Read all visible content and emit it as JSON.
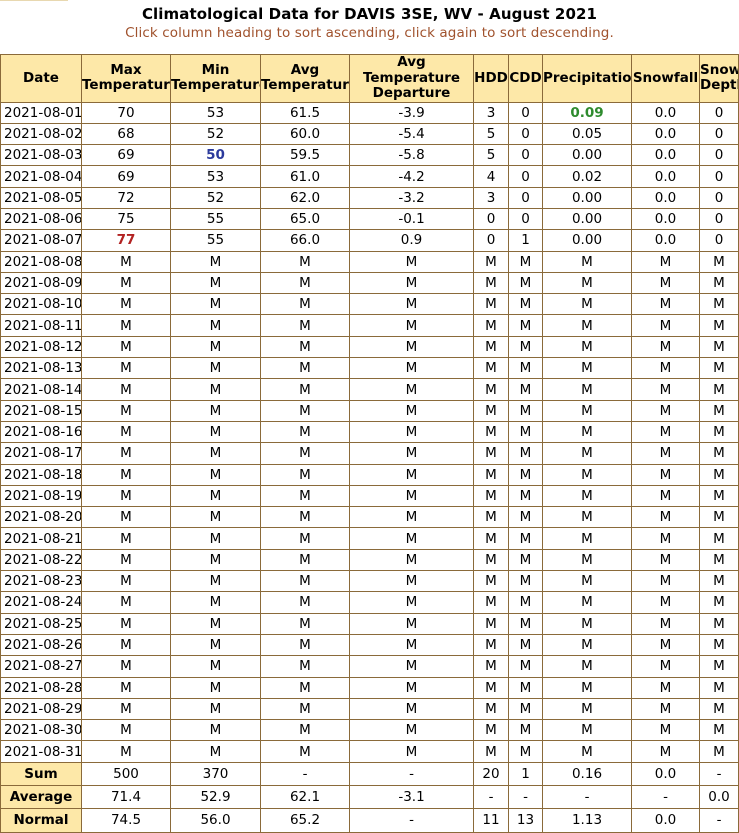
{
  "title": "Climatological Data for DAVIS 3SE, WV - August 2021",
  "subtitle": "Click column heading to sort ascending, click again to sort descending.",
  "headers": [
    [
      "Date"
    ],
    [
      "Max",
      "Temperature"
    ],
    [
      "Min",
      "Temperature"
    ],
    [
      "Avg",
      "Temperature"
    ],
    [
      "Avg Temperature",
      "Departure"
    ],
    [
      "HDD"
    ],
    [
      "CDD"
    ],
    [
      "Precipitation"
    ],
    [
      "Snowfall"
    ],
    [
      "Snow",
      "Depth"
    ]
  ],
  "rows": [
    [
      "2021-08-01",
      "70",
      "53",
      "61.5",
      "-3.9",
      "3",
      "0",
      "0.09",
      "0.0",
      "0"
    ],
    [
      "2021-08-02",
      "68",
      "52",
      "60.0",
      "-5.4",
      "5",
      "0",
      "0.05",
      "0.0",
      "0"
    ],
    [
      "2021-08-03",
      "69",
      "50",
      "59.5",
      "-5.8",
      "5",
      "0",
      "0.00",
      "0.0",
      "0"
    ],
    [
      "2021-08-04",
      "69",
      "53",
      "61.0",
      "-4.2",
      "4",
      "0",
      "0.02",
      "0.0",
      "0"
    ],
    [
      "2021-08-05",
      "72",
      "52",
      "62.0",
      "-3.2",
      "3",
      "0",
      "0.00",
      "0.0",
      "0"
    ],
    [
      "2021-08-06",
      "75",
      "55",
      "65.0",
      "-0.1",
      "0",
      "0",
      "0.00",
      "0.0",
      "0"
    ],
    [
      "2021-08-07",
      "77",
      "55",
      "66.0",
      "0.9",
      "0",
      "1",
      "0.00",
      "0.0",
      "0"
    ],
    [
      "2021-08-08",
      "M",
      "M",
      "M",
      "M",
      "M",
      "M",
      "M",
      "M",
      "M"
    ],
    [
      "2021-08-09",
      "M",
      "M",
      "M",
      "M",
      "M",
      "M",
      "M",
      "M",
      "M"
    ],
    [
      "2021-08-10",
      "M",
      "M",
      "M",
      "M",
      "M",
      "M",
      "M",
      "M",
      "M"
    ],
    [
      "2021-08-11",
      "M",
      "M",
      "M",
      "M",
      "M",
      "M",
      "M",
      "M",
      "M"
    ],
    [
      "2021-08-12",
      "M",
      "M",
      "M",
      "M",
      "M",
      "M",
      "M",
      "M",
      "M"
    ],
    [
      "2021-08-13",
      "M",
      "M",
      "M",
      "M",
      "M",
      "M",
      "M",
      "M",
      "M"
    ],
    [
      "2021-08-14",
      "M",
      "M",
      "M",
      "M",
      "M",
      "M",
      "M",
      "M",
      "M"
    ],
    [
      "2021-08-15",
      "M",
      "M",
      "M",
      "M",
      "M",
      "M",
      "M",
      "M",
      "M"
    ],
    [
      "2021-08-16",
      "M",
      "M",
      "M",
      "M",
      "M",
      "M",
      "M",
      "M",
      "M"
    ],
    [
      "2021-08-17",
      "M",
      "M",
      "M",
      "M",
      "M",
      "M",
      "M",
      "M",
      "M"
    ],
    [
      "2021-08-18",
      "M",
      "M",
      "M",
      "M",
      "M",
      "M",
      "M",
      "M",
      "M"
    ],
    [
      "2021-08-19",
      "M",
      "M",
      "M",
      "M",
      "M",
      "M",
      "M",
      "M",
      "M"
    ],
    [
      "2021-08-20",
      "M",
      "M",
      "M",
      "M",
      "M",
      "M",
      "M",
      "M",
      "M"
    ],
    [
      "2021-08-21",
      "M",
      "M",
      "M",
      "M",
      "M",
      "M",
      "M",
      "M",
      "M"
    ],
    [
      "2021-08-22",
      "M",
      "M",
      "M",
      "M",
      "M",
      "M",
      "M",
      "M",
      "M"
    ],
    [
      "2021-08-23",
      "M",
      "M",
      "M",
      "M",
      "M",
      "M",
      "M",
      "M",
      "M"
    ],
    [
      "2021-08-24",
      "M",
      "M",
      "M",
      "M",
      "M",
      "M",
      "M",
      "M",
      "M"
    ],
    [
      "2021-08-25",
      "M",
      "M",
      "M",
      "M",
      "M",
      "M",
      "M",
      "M",
      "M"
    ],
    [
      "2021-08-26",
      "M",
      "M",
      "M",
      "M",
      "M",
      "M",
      "M",
      "M",
      "M"
    ],
    [
      "2021-08-27",
      "M",
      "M",
      "M",
      "M",
      "M",
      "M",
      "M",
      "M",
      "M"
    ],
    [
      "2021-08-28",
      "M",
      "M",
      "M",
      "M",
      "M",
      "M",
      "M",
      "M",
      "M"
    ],
    [
      "2021-08-29",
      "M",
      "M",
      "M",
      "M",
      "M",
      "M",
      "M",
      "M",
      "M"
    ],
    [
      "2021-08-30",
      "M",
      "M",
      "M",
      "M",
      "M",
      "M",
      "M",
      "M",
      "M"
    ],
    [
      "2021-08-31",
      "M",
      "M",
      "M",
      "M",
      "M",
      "M",
      "M",
      "M",
      "M"
    ]
  ],
  "highlights": {
    "max_temperature": {
      "row": 6,
      "col": 1,
      "color": "#b22222"
    },
    "min_temperature": {
      "row": 2,
      "col": 2,
      "color": "#2b3a9c"
    },
    "max_precipitation": {
      "row": 0,
      "col": 7,
      "color": "#2e8b2e"
    }
  },
  "summary": [
    [
      "Sum",
      "500",
      "370",
      "-",
      "-",
      "20",
      "1",
      "0.16",
      "0.0",
      "-"
    ],
    [
      "Average",
      "71.4",
      "52.9",
      "62.1",
      "-3.1",
      "-",
      "-",
      "-",
      "-",
      "0.0"
    ],
    [
      "Normal",
      "74.5",
      "56.0",
      "65.2",
      "-",
      "11",
      "13",
      "1.13",
      "0.0",
      "-"
    ]
  ],
  "colors": {
    "header_bg": "#fde8a8",
    "border": "#8a6a3a",
    "subtitle": "#a0522d"
  }
}
